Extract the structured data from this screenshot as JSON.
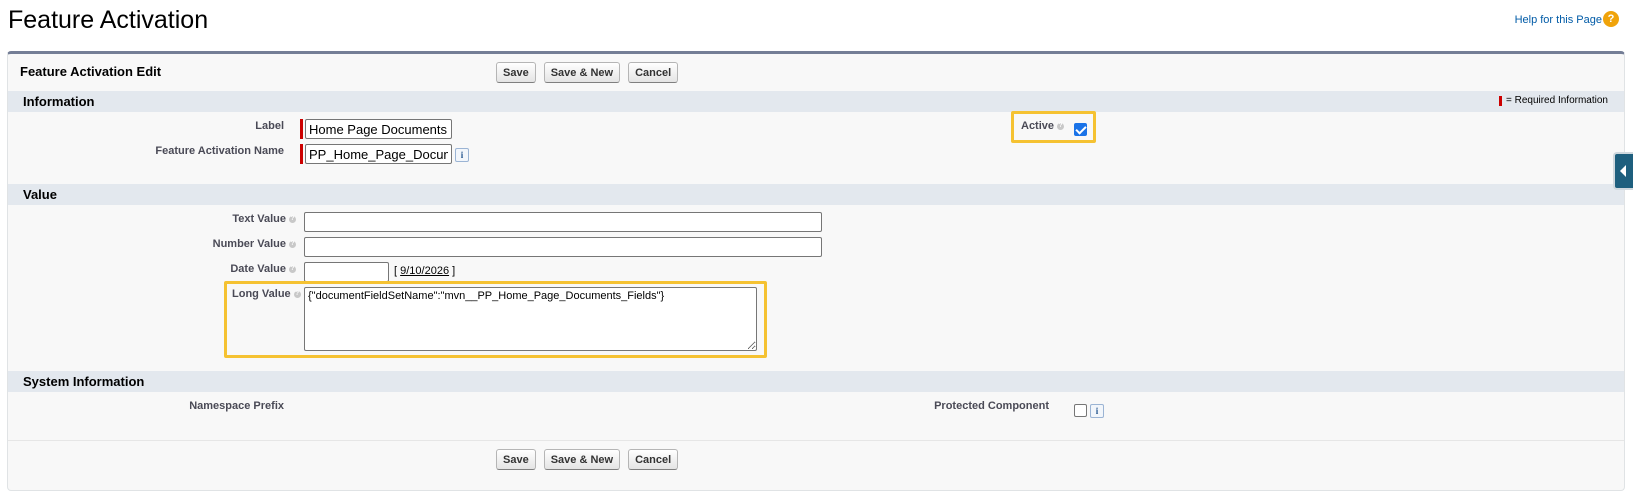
{
  "page": {
    "title": "Feature Activation",
    "help_link": "Help for this Page",
    "help_icon": "help-icon"
  },
  "edit": {
    "title": "Feature Activation Edit",
    "buttons": {
      "save": "Save",
      "save_new": "Save & New",
      "cancel": "Cancel"
    }
  },
  "information": {
    "title": "Information",
    "required_legend": "= Required Information",
    "label_label": "Label",
    "label_value": "Home Page Documents",
    "name_label": "Feature Activation Name",
    "name_value": "PP_Home_Page_Documents",
    "active_label": "Active",
    "active_checked": true
  },
  "value": {
    "title": "Value",
    "text_label": "Text Value",
    "text_value": "",
    "number_label": "Number Value",
    "number_value": "",
    "date_label": "Date Value",
    "date_value": "",
    "date_today": "9/10/2026",
    "long_label": "Long Value",
    "long_value": "{\"documentFieldSetName\":\"mvn__PP_Home_Page_Documents_Fields\"}"
  },
  "system": {
    "title": "System Information",
    "namespace_label": "Namespace Prefix",
    "protected_label": "Protected Component",
    "protected_checked": false
  },
  "colors": {
    "highlight": "#f5c232",
    "required": "#cc0000",
    "section_bg": "#e3e8ee",
    "link": "#015ba7"
  }
}
